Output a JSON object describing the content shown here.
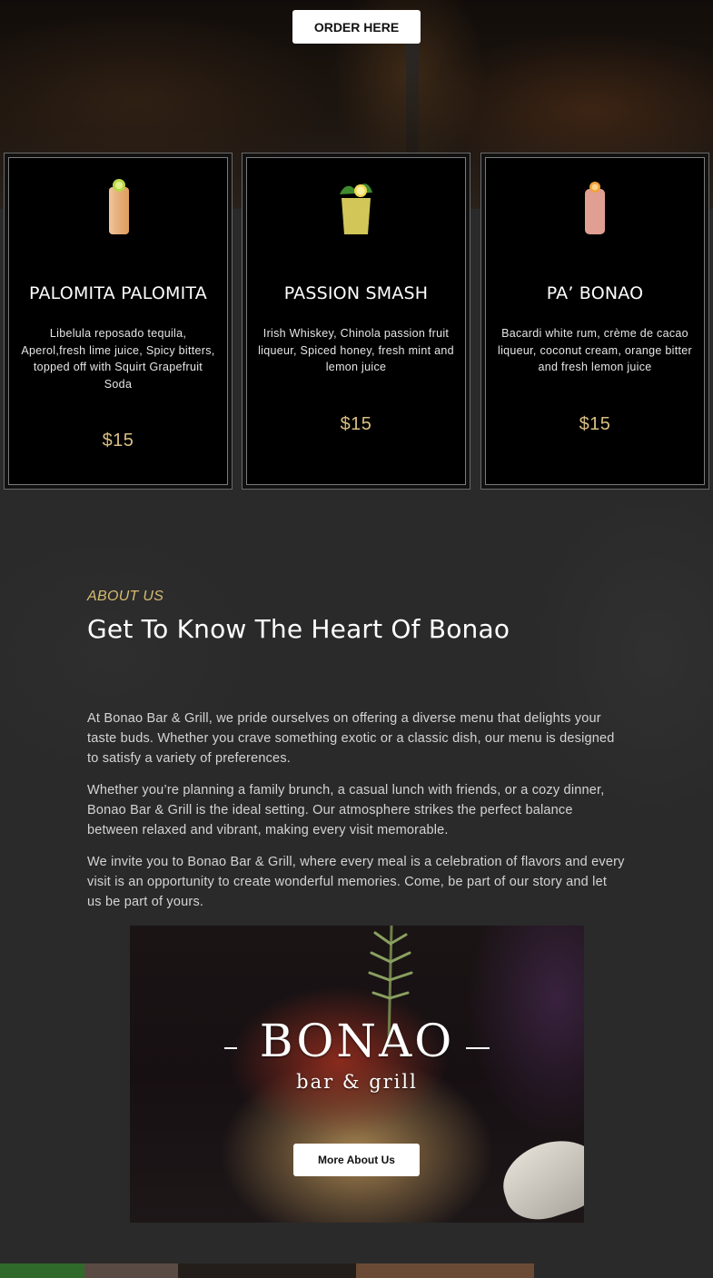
{
  "hero": {
    "order_label": "ORDER HERE"
  },
  "drinks": [
    {
      "name": "PALOMITA PALOMITA",
      "description": "Libelula reposado tequila, Aperol,fresh lime juice, Spicy bitters, topped off with Squirt Grapefruit Soda",
      "price": "$15",
      "icon": "cocktail-glass-icon"
    },
    {
      "name": "PASSION SMASH",
      "description": "Irish Whiskey, Chinola passion fruit liqueur, Spiced honey, fresh mint and lemon juice",
      "price": "$15",
      "icon": "cocktail-glass-icon"
    },
    {
      "name": "PA’ BONAO",
      "description": "Bacardi white rum, crème de cacao liqueur, coconut cream, orange bitter and fresh lemon juice",
      "price": "$15",
      "icon": "cocktail-glass-icon"
    }
  ],
  "about": {
    "kicker": "ABOUT US",
    "title": "Get To Know The Heart Of Bonao",
    "paragraphs": [
      "At Bonao Bar & Grill, we pride ourselves on offering a diverse menu that delights your taste buds. Whether you crave something exotic or a classic dish, our menu is designed to satisfy a variety of preferences.",
      "Whether you’re planning a family brunch, a casual lunch with friends, or a cozy dinner, Bonao Bar & Grill is the ideal setting. Our atmosphere strikes the perfect balance between relaxed and vibrant, making every visit memorable.",
      "We invite you to Bonao Bar & Grill, where every meal is a celebration of flavors and every visit is an opportunity to create wonderful memories. Come, be part of our story and let us be part of yours."
    ],
    "logo_main": "BONAO",
    "logo_sub": "bar & grill",
    "more_label": "More About Us"
  },
  "colors": {
    "accent_gold": "#d6bb72",
    "price_gold": "#d9bf82",
    "background": "#2a2a2a"
  }
}
